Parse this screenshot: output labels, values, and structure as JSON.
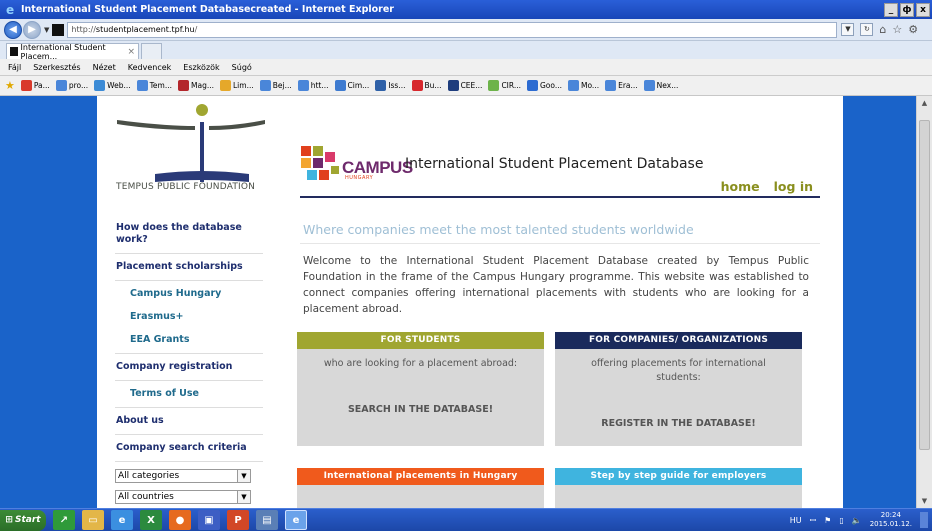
{
  "window": {
    "title": "International Student Placement Databasecreated - Internet Explorer",
    "buttons": [
      "_",
      "ф",
      "x"
    ]
  },
  "address": {
    "url_prefix": "http://",
    "url_domain": "studentplacement.tpf.hu",
    "url_suffix": "/"
  },
  "tab": {
    "label": "International Student Placem...",
    "close": "×"
  },
  "menu": [
    "Fájl",
    "Szerkesztés",
    "Nézet",
    "Kedvencek",
    "Eszközök",
    "Súgó"
  ],
  "favorites": [
    {
      "label": "Pa...",
      "color": "#d93a2b"
    },
    {
      "label": "pro...",
      "color": "#4a86d9"
    },
    {
      "label": "Web...",
      "color": "#3c8bd6"
    },
    {
      "label": "Tem...",
      "color": "#4a86d9"
    },
    {
      "label": "Mag...",
      "color": "#b3262b"
    },
    {
      "label": "Lim...",
      "color": "#e5a82a"
    },
    {
      "label": "Bej...",
      "color": "#4a86d9"
    },
    {
      "label": "htt...",
      "color": "#4a86d9"
    },
    {
      "label": "Cim...",
      "color": "#3e7bd0"
    },
    {
      "label": "Iss...",
      "color": "#2f61a8"
    },
    {
      "label": "Bu...",
      "color": "#d7282d"
    },
    {
      "label": "CEE...",
      "color": "#1e3d7d"
    },
    {
      "label": "CIR...",
      "color": "#6db34a"
    },
    {
      "label": "Goo...",
      "color": "#2c6bd1"
    },
    {
      "label": "Mo...",
      "color": "#4a86d9"
    },
    {
      "label": "Era...",
      "color": "#4a86d9"
    },
    {
      "label": "Nex...",
      "color": "#4a86d9"
    }
  ],
  "header": {
    "tpf_name": "TEMPUS PUBLIC FOUNDATION",
    "campus_word": "CAMPUS",
    "campus_sub": "HUNGARY",
    "site_title": "International Student Placement Database",
    "links": {
      "home": "home",
      "login": "log in"
    }
  },
  "sidebar": {
    "how_it_works": "How does the database work?",
    "placement_scholarships": "Placement scholarships",
    "campus_hungary": "Campus Hungary",
    "erasmus": "Erasmus+",
    "eea_grants": "EEA Grants",
    "company_registration": "Company registration",
    "terms_of_use": "Terms of Use",
    "about_us": "About us",
    "search_criteria": "Company search criteria",
    "category_select": "All categories",
    "country_select": "All countries"
  },
  "main": {
    "tagline": "Where companies meet the most talented students worldwide",
    "welcome": "Welcome to the International Student Placement Database created by Tempus Public Foundation in the frame of the Campus Hungary programme. This website was established to connect companies offering international placements with students who are looking for a placement abroad."
  },
  "boxes": {
    "students": {
      "title": "FOR STUDENTS",
      "subtitle": "who are looking for a placement abroad:",
      "cta": "SEARCH IN THE DATABASE!",
      "color": "#a0a631"
    },
    "companies": {
      "title": "FOR COMPANIES/ ORGANIZATIONS",
      "subtitle": "offering placements for international students:",
      "cta": "REGISTER IN THE DATABASE!",
      "color": "#1a2a5c"
    },
    "hungary": {
      "title": "International placements in Hungary",
      "color": "#f05a1c"
    },
    "guide": {
      "title": "Step by step guide for employers",
      "color": "#3fb4df"
    }
  },
  "taskbar": {
    "start": "Start",
    "lang": "HU",
    "time": "20:24",
    "date": "2015.01.12."
  }
}
